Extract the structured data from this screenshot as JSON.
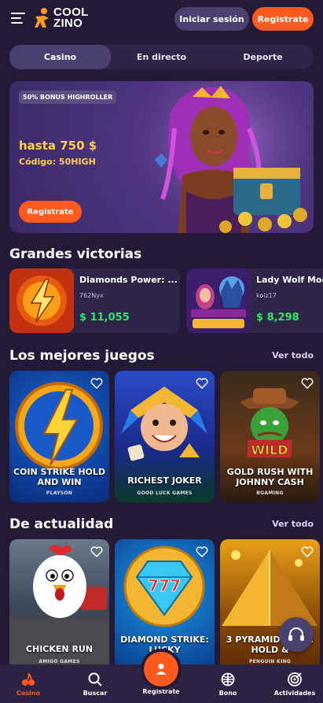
{
  "header": {
    "logo_line1": "COOL",
    "logo_line2": "ZINO",
    "login_label": "Iniciar sesión",
    "register_label": "Registrate"
  },
  "tabs": [
    {
      "label": "Casino",
      "active": true
    },
    {
      "label": "En directo",
      "active": false
    },
    {
      "label": "Deporte",
      "active": false
    }
  ],
  "banner": {
    "tag": "50% BONUS HIGHROLLER",
    "amount": "hasta 750 $",
    "code": "Código: 50HIGH",
    "button": "Registrate"
  },
  "wins": {
    "title": "Grandes victorias",
    "items": [
      {
        "game": "Diamonds Power: ...",
        "user": "762Nyx",
        "amount": "$ 11,055"
      },
      {
        "game": "Lady Wolf Moo",
        "user": "kolz17",
        "amount": "$ 8,298"
      }
    ]
  },
  "best_games": {
    "title": "Los mejores juegos",
    "see_all": "Ver todo",
    "items": [
      {
        "name": "COIN STRIKE HOLD AND WIN",
        "provider": "PLAYSON"
      },
      {
        "name": "RICHEST JOKER",
        "provider": "GOOD LUCK GAMES"
      },
      {
        "name": "GOLD RUSH WITH JOHNNY CASH",
        "provider": "BGAMING"
      }
    ]
  },
  "trending": {
    "title": "De actualidad",
    "see_all": "Ver todo",
    "items": [
      {
        "name": "CHICKEN RUN",
        "provider": "AMIGO GAMES"
      },
      {
        "name": "DIAMOND STRIKE: LUCKY",
        "provider": ""
      },
      {
        "name": "3 PYRAMID GOLD: HOLD &",
        "provider": "PENGUIN KING"
      }
    ]
  },
  "bottom_nav": [
    {
      "label": "Casino",
      "icon": "cherry-icon",
      "active": true
    },
    {
      "label": "Buscar",
      "icon": "search-icon",
      "active": false
    },
    {
      "label": "Registrate",
      "icon": "user-icon",
      "active": false
    },
    {
      "label": "Bono",
      "icon": "gift-icon",
      "active": false
    },
    {
      "label": "Actividades",
      "icon": "target-icon",
      "active": false
    }
  ],
  "colors": {
    "background": "#231a38",
    "accent": "#ff5a1e",
    "win_green": "#2ee66a",
    "bonus_yellow": "#ffd04a"
  }
}
